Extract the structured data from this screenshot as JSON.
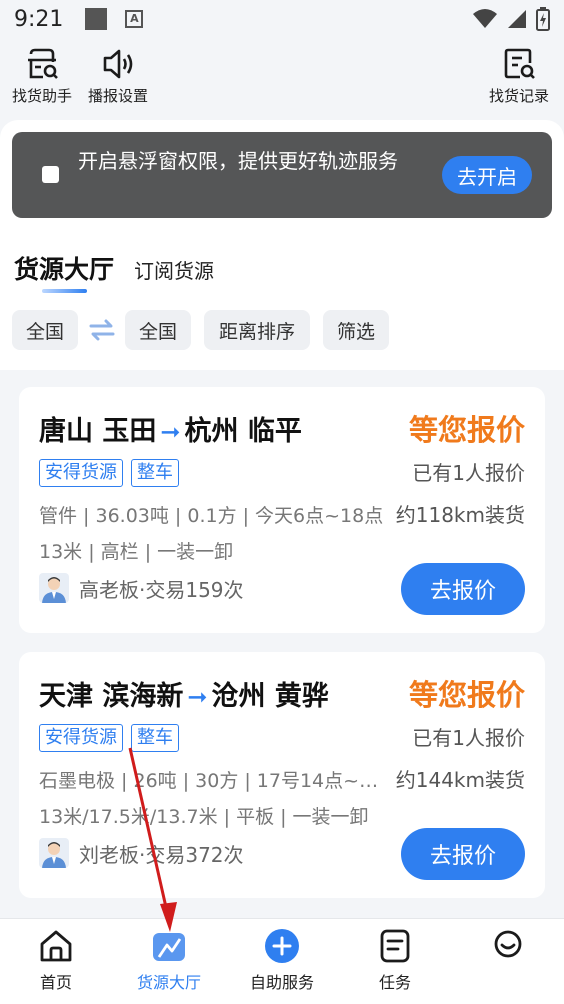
{
  "status_bar": {
    "time": "9:21"
  },
  "toolbar": {
    "finder_assistant": "找货助手",
    "broadcast_settings": "播报设置",
    "finder_records": "找货记录"
  },
  "banner": {
    "message": "开启悬浮窗权限，提供更好轨迹服务",
    "button": "去开启"
  },
  "tabs": {
    "main": "货源大厅",
    "sub": "订阅货源"
  },
  "filters": {
    "from": "全国",
    "to": "全国",
    "sort": "距离排序",
    "filter": "筛选",
    "swap_icon": "swap-arrows-icon"
  },
  "cards": [
    {
      "origin": "唐山 玉田",
      "destination": "杭州 临平",
      "status": "等您报价",
      "tags": [
        "安得货源",
        "整车"
      ],
      "quote_count": "已有1人报价",
      "desc1": "管件 | 36.03吨 | 0.1方 | 今天6点~18点",
      "desc2": "13米 | 高栏 | 一装一卸",
      "distance": "约118km装货",
      "owner": "高老板·交易159次",
      "button": "去报价"
    },
    {
      "origin": "天津 滨海新",
      "destination": "沧州 黄骅",
      "status": "等您报价",
      "tags": [
        "安得货源",
        "整车"
      ],
      "quote_count": "已有1人报价",
      "desc1": "石墨电极 | 26吨 | 30方 | 17号14点~18点",
      "desc2": "13米/17.5米/13.7米 | 平板 | 一装一卸",
      "distance": "约144km装货",
      "owner": "刘老板·交易372次",
      "button": "去报价"
    }
  ],
  "bottom_nav": {
    "home": "首页",
    "cargo_hall": "货源大厅",
    "self_service": "自助服务",
    "tasks": "任务",
    "mine": ""
  },
  "colors": {
    "accent": "#2f7ff0",
    "quote_orange": "#f07a1c",
    "banner_bg": "#555657",
    "annotation_red": "#d01c1c"
  }
}
